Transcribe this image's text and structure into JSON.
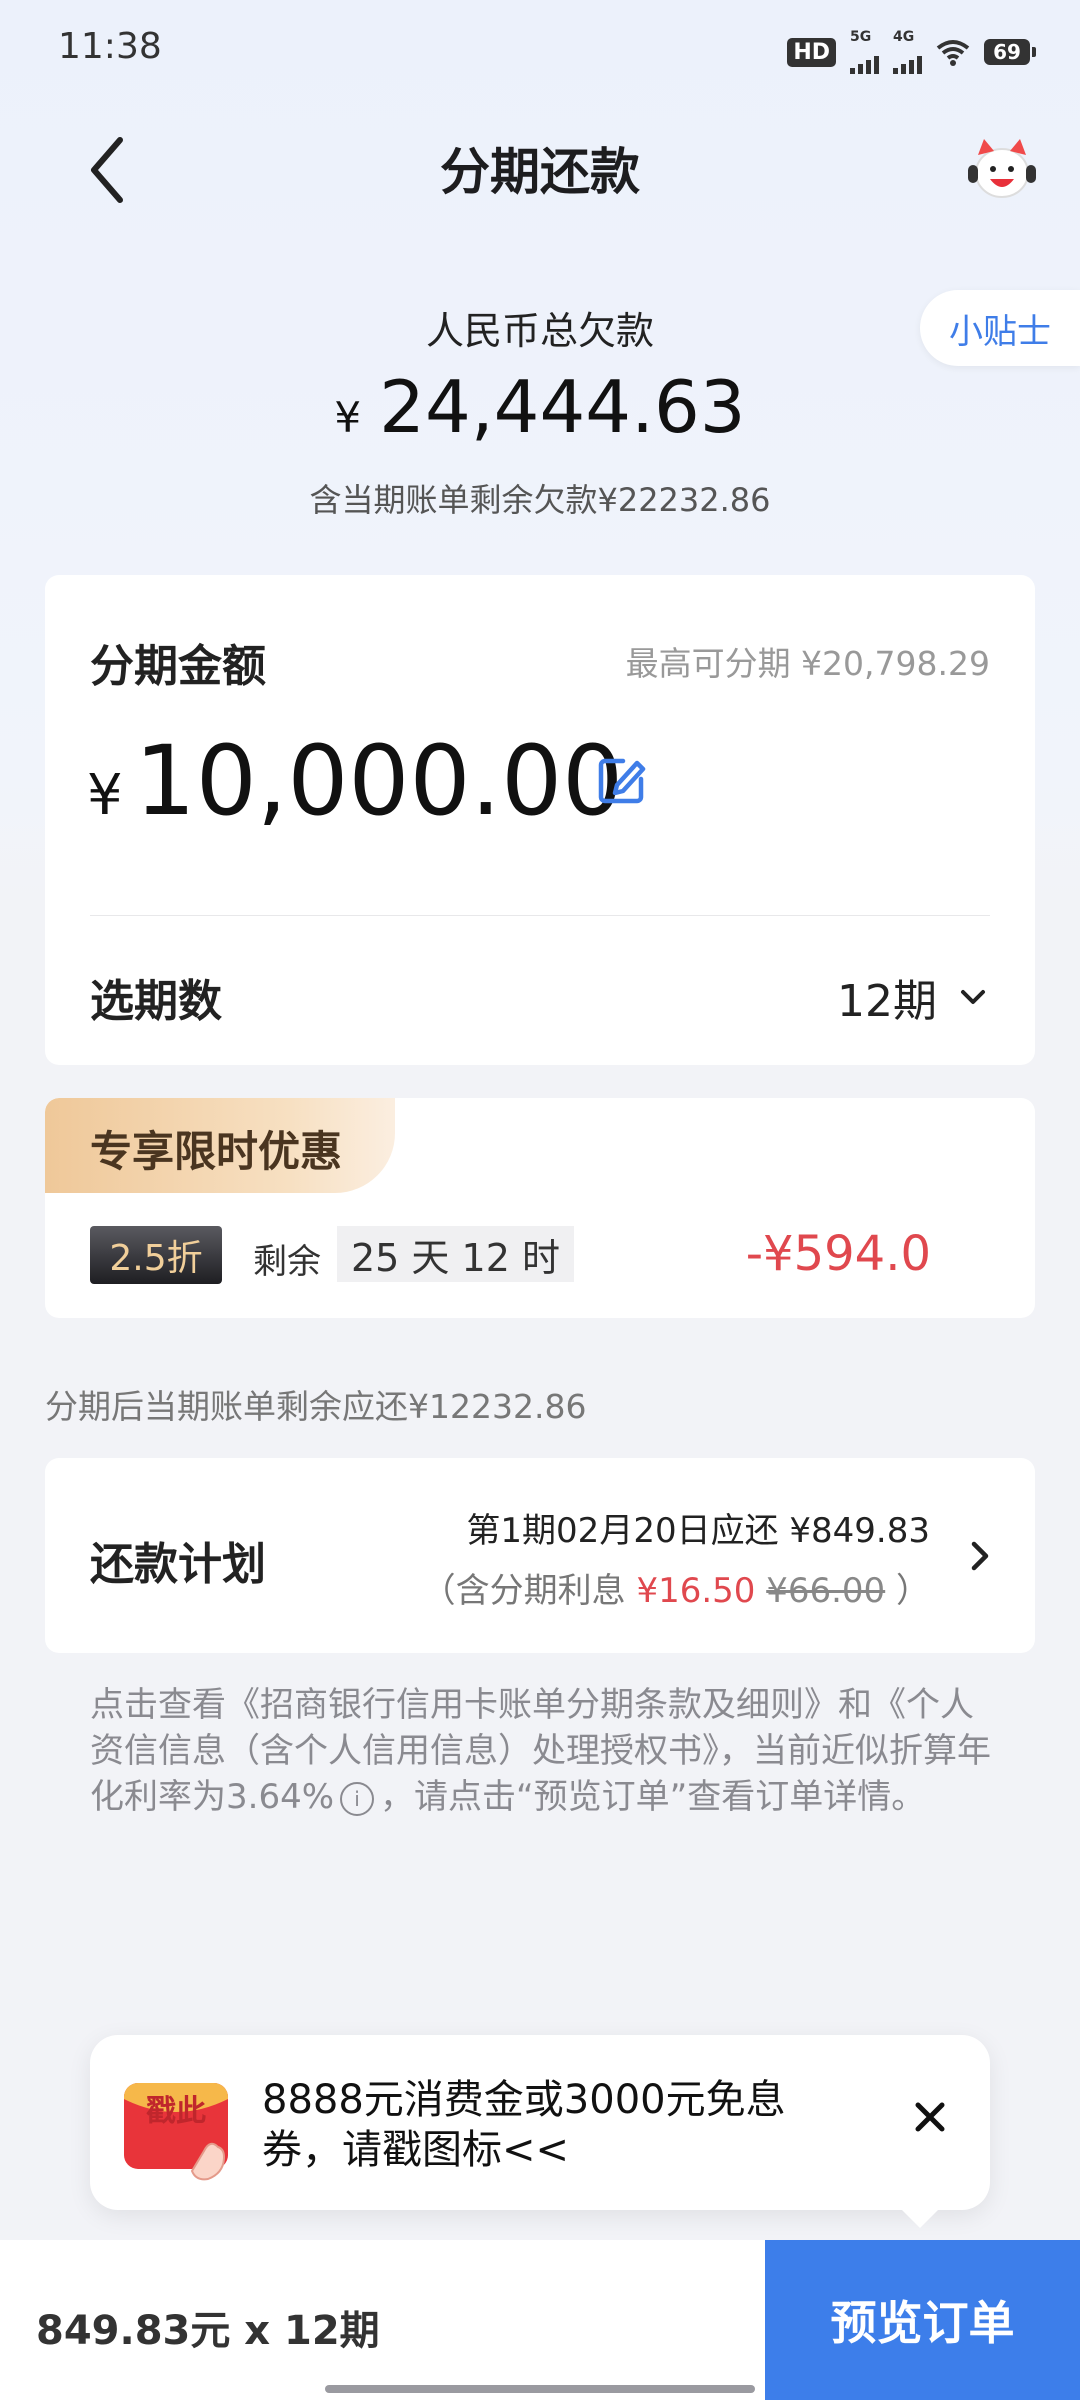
{
  "status_bar": {
    "time": "11:38",
    "hd_label": "HD",
    "signal1_label": "5G",
    "signal2_label": "4G",
    "battery": "69"
  },
  "header": {
    "title": "分期还款",
    "back_icon": "chevron-left-icon",
    "service_icon": "mascot-service-icon"
  },
  "tips_button": "小贴士",
  "summary": {
    "label": "人民币总欠款",
    "currency": "¥",
    "amount": "24,444.63",
    "sub": "含当期账单剩余欠款¥22232.86"
  },
  "installment_card": {
    "label": "分期金额",
    "max_text": "最高可分期 ¥20,798.29",
    "currency": "¥",
    "amount": "10,000.00",
    "periods_label": "选期数",
    "periods_value": "12期"
  },
  "promo": {
    "tag": "专享限时优惠",
    "discount": "2.5折",
    "remain_label": "剩余",
    "remain_time": "25 天 12 时",
    "saving": "-¥594.0"
  },
  "after_installment_text": "分期后当期账单剩余应还¥12232.86",
  "plan": {
    "label": "还款计划",
    "line1": "第1期02月20日应还 ¥849.83",
    "line2_prefix": "（含分期利息 ",
    "interest_now": "¥16.50",
    "interest_original": "¥66.00",
    "line2_suffix": " ）"
  },
  "terms": {
    "part1": "点击查看《招商银行信用卡账单分期条款及细则》和《个人资信信息（含个人信用信息）处理授权书》，当前近似折算年化利率为3.64%",
    "info_glyph": "i",
    "part2": "，请点击“预览订单”查看订单详情。"
  },
  "popup": {
    "icon_label": "戳此",
    "text": "8888元消费金或3000元免息券，请戳图标<<"
  },
  "bottom_bar": {
    "summary": "849.83元 x 12期",
    "button": "预览订单"
  },
  "colors": {
    "accent": "#3d7eea",
    "discount_red": "#e0484e",
    "promo_gold": "#efc899"
  }
}
